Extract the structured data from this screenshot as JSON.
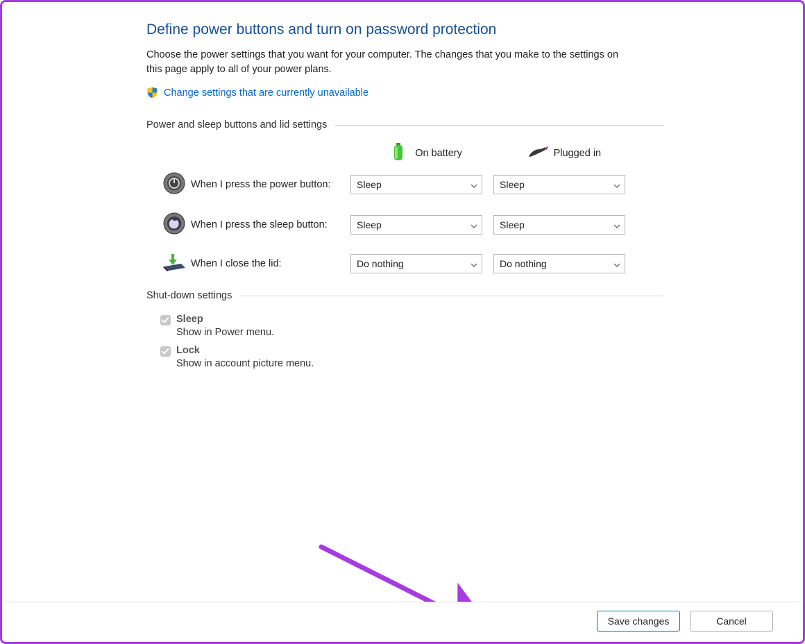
{
  "header": {
    "title": "Define power buttons and turn on password protection",
    "description": "Choose the power settings that you want for your computer. The changes that you make to the settings on this page apply to all of your power plans.",
    "admin_link": "Change settings that are currently unavailable"
  },
  "power_section": {
    "group_label": "Power and sleep buttons and lid settings",
    "col_battery_label": "On battery",
    "col_plugged_label": "Plugged in",
    "rows": [
      {
        "label": "When I press the power button:",
        "battery_value": "Sleep",
        "plugged_value": "Sleep"
      },
      {
        "label": "When I press the sleep button:",
        "battery_value": "Sleep",
        "plugged_value": "Sleep"
      },
      {
        "label": "When I close the lid:",
        "battery_value": "Do nothing",
        "plugged_value": "Do nothing"
      }
    ]
  },
  "shutdown_section": {
    "group_label": "Shut-down settings",
    "items": [
      {
        "title": "Sleep",
        "desc": "Show in Power menu."
      },
      {
        "title": "Lock",
        "desc": "Show in account picture menu."
      }
    ]
  },
  "buttons": {
    "save": "Save changes",
    "cancel": "Cancel"
  }
}
